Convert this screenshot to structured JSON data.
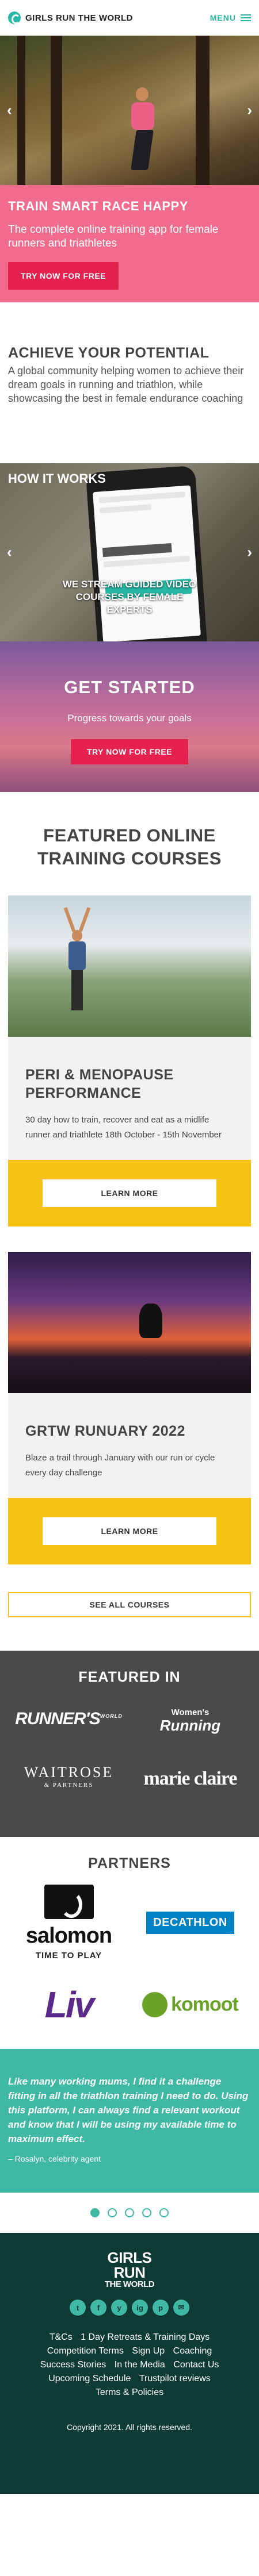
{
  "header": {
    "logo_text": "GIRLS RUN THE WORLD",
    "menu_label": "MENU"
  },
  "hero": {
    "prev_label": "‹",
    "next_label": "›",
    "title": "TRAIN SMART RACE HAPPY",
    "description": "The complete online training app for female runners and triathletes",
    "cta_label": "TRY NOW FOR FREE"
  },
  "achieve": {
    "title": "ACHIEVE YOUR POTENTIAL",
    "text": "A global community helping women to achieve their dream goals in running and triathlon, while showcasing the best in female endurance coaching"
  },
  "how": {
    "title": "HOW IT WORKS",
    "caption": "WE STREAM GUIDED VIDEO COURSES BY FEMALE EXPERTS",
    "prev_label": "‹",
    "next_label": "›"
  },
  "started": {
    "title": "GET STARTED",
    "text": "Progress towards your goals",
    "cta_label": "TRY NOW FOR FREE"
  },
  "featured": {
    "title": "FEATURED ONLINE TRAINING COURSES",
    "courses": [
      {
        "title": "PERI & MENOPAUSE PERFORMANCE",
        "text": "30 day how to train, recover and eat as a midlife runner and triathlete 18th October - 15th November",
        "cta_label": "LEARN MORE"
      },
      {
        "title": "GRTW RUNUARY 2022",
        "text": "Blaze a trail through January with our run or cycle every day challenge",
        "cta_label": "LEARN MORE"
      }
    ],
    "see_all_label": "SEE ALL COURSES"
  },
  "featured_in": {
    "title": "FEATURED IN",
    "runners": "RUNNER'S",
    "runners_suffix": "WORLD",
    "wr_top": "Women's",
    "wr_main": "Running",
    "waitrose": "WAITROSE",
    "waitrose_sub": "& PARTNERS",
    "marie_claire": "marie claire"
  },
  "partners": {
    "title": "PARTNERS",
    "salomon": "salomon",
    "salomon_tag": "TIME TO PLAY",
    "decathlon": "DECATHLON",
    "liv": "Liv",
    "komoot": "komoot"
  },
  "testimonial": {
    "quote": "Like many working mums, I find it a challenge fitting in all the triathlon training I need to do. Using this platform, I can always find a relevant workout and know that I will be using my available time to maximum effect.",
    "author": "– Rosalyn, celebrity agent"
  },
  "footer": {
    "logo_line1": "GIRLS",
    "logo_line2": "RUN",
    "logo_line3": "THE WORLD",
    "links": [
      "T&Cs",
      "1 Day Retreats & Training Days",
      "Competition Terms",
      "Sign Up",
      "Coaching",
      "Success Stories",
      "In the Media",
      "Contact Us",
      "Upcoming Schedule",
      "Trustpilot reviews",
      "Terms & Policies"
    ],
    "copyright": "Copyright 2021. All rights reserved.",
    "socials": [
      "t",
      "f",
      "y",
      "ig",
      "p",
      "✉"
    ]
  },
  "colors": {
    "accent": "#26b8a4",
    "pink": "#f06b8c",
    "cta_red": "#e5214f",
    "yellow": "#f5c316",
    "footer": "#0e3b36"
  }
}
